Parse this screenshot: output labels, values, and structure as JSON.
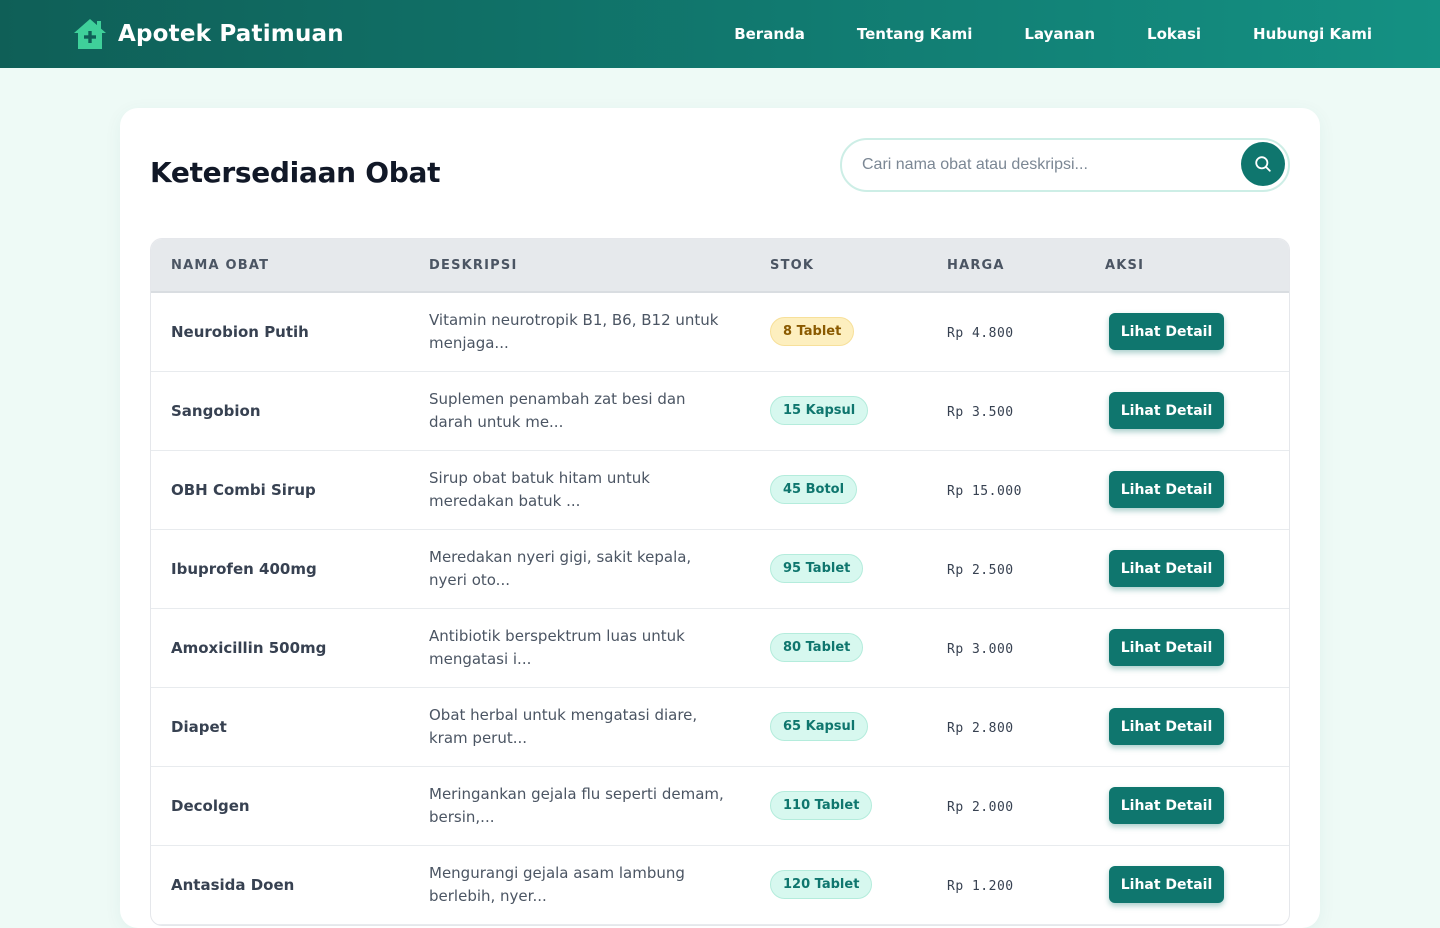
{
  "header": {
    "brand": "Apotek Patimuan",
    "brand_icon": "house-plus-icon",
    "nav": [
      {
        "label": "Beranda"
      },
      {
        "label": "Tentang Kami"
      },
      {
        "label": "Layanan"
      },
      {
        "label": "Lokasi"
      },
      {
        "label": "Hubungi Kami"
      }
    ]
  },
  "main": {
    "title": "Ketersediaan Obat",
    "search": {
      "placeholder": "Cari nama obat atau deskripsi...",
      "value": "",
      "icon": "search-icon"
    },
    "table": {
      "columns": [
        "NAMA OBAT",
        "DESKRIPSI",
        "STOK",
        "HARGA",
        "AKSI"
      ],
      "rows": [
        {
          "name": "Neurobion Putih",
          "desc": "Vitamin neurotropik B1, B6, B12 untuk menjaga...",
          "stock": "8 Tablet",
          "stock_level": "low",
          "price": "Rp 4.800",
          "action": "Lihat Detail"
        },
        {
          "name": "Sangobion",
          "desc": "Suplemen penambah zat besi dan darah untuk me...",
          "stock": "15 Kapsul",
          "stock_level": "ok",
          "price": "Rp 3.500",
          "action": "Lihat Detail"
        },
        {
          "name": "OBH Combi Sirup",
          "desc": "Sirup obat batuk hitam untuk meredakan batuk ...",
          "stock": "45 Botol",
          "stock_level": "ok",
          "price": "Rp 15.000",
          "action": "Lihat Detail"
        },
        {
          "name": "Ibuprofen 400mg",
          "desc": "Meredakan nyeri gigi, sakit kepala, nyeri oto...",
          "stock": "95 Tablet",
          "stock_level": "ok",
          "price": "Rp 2.500",
          "action": "Lihat Detail"
        },
        {
          "name": "Amoxicillin 500mg",
          "desc": "Antibiotik berspektrum luas untuk mengatasi i...",
          "stock": "80 Tablet",
          "stock_level": "ok",
          "price": "Rp 3.000",
          "action": "Lihat Detail"
        },
        {
          "name": "Diapet",
          "desc": "Obat herbal untuk mengatasi diare, kram perut...",
          "stock": "65 Kapsul",
          "stock_level": "ok",
          "price": "Rp 2.800",
          "action": "Lihat Detail"
        },
        {
          "name": "Decolgen",
          "desc": "Meringankan gejala flu seperti demam, bersin,...",
          "stock": "110 Tablet",
          "stock_level": "ok",
          "price": "Rp 2.000",
          "action": "Lihat Detail"
        },
        {
          "name": "Antasida Doen",
          "desc": "Mengurangi gejala asam lambung berlebih, nyer...",
          "stock": "120 Tablet",
          "stock_level": "ok",
          "price": "Rp 1.200",
          "action": "Lihat Detail"
        }
      ]
    }
  },
  "colors": {
    "primary": "#0f766e",
    "accent": "#22c08a",
    "low_stock_bg": "#fdefbf",
    "ok_stock_bg": "#d7f8ef"
  }
}
